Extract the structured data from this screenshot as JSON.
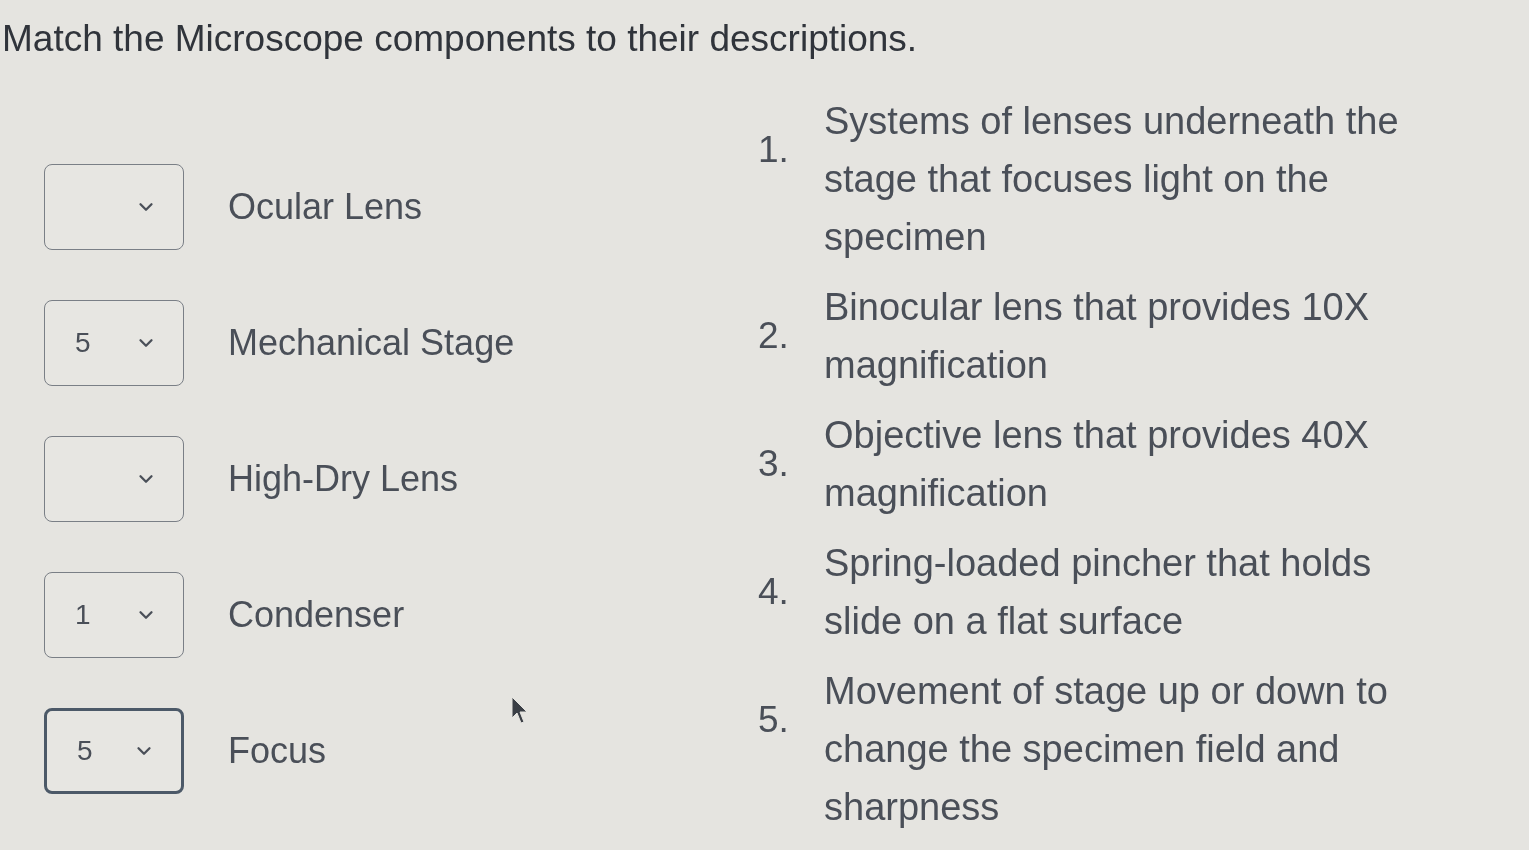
{
  "title": "Match the Microscope components to their descriptions.",
  "components": [
    {
      "label": "Ocular Lens",
      "focused": false
    },
    {
      "value": "5",
      "label": "Mechanical Stage",
      "focused": false
    },
    {
      "label": "High-Dry Lens",
      "focused": false
    },
    {
      "value": "1",
      "label": "Condenser",
      "focused": false
    },
    {
      "value": "5",
      "label": "Focus",
      "focused": true
    }
  ],
  "descriptions": [
    {
      "number": "1.",
      "text": "Systems of lenses underneath the stage that focuses light on the specimen"
    },
    {
      "number": "2.",
      "text": "Binocular lens that provides 10X magnification"
    },
    {
      "number": "3.",
      "text": "Objective lens that provides 40X magnification"
    },
    {
      "number": "4.",
      "text": "Spring-loaded pincher that holds slide on a flat surface"
    },
    {
      "number": "5.",
      "text": "Movement of stage up or down to change the specimen field and sharpness"
    }
  ]
}
